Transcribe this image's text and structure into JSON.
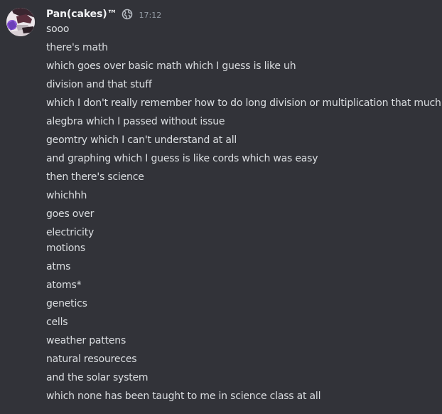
{
  "message": {
    "username": "Pan(cakes)™",
    "timestamp": "17:12",
    "badge_icon": "globe-icon",
    "lines": [
      "sooo",
      "there's math",
      "which goes over basic math which I guess is like uh",
      "division and that stuff",
      "which I don't really remember how to do long division or multiplication that much",
      "alegbra which I passed without issue",
      "geomtry which I can't understand at all",
      "and graphing which I guess is like cords which was easy",
      "then there's science",
      "whichhh",
      "goes over",
      "electricity",
      "motions",
      "atms",
      "atoms*",
      "genetics",
      "cells",
      "weather pattens",
      "natural resoureces",
      "and the solar system",
      "which none has been taught to me in science class at all"
    ]
  },
  "colors": {
    "background": "#323339",
    "username": "#f2f3f5",
    "text": "#dbdee1",
    "timestamp": "#949ba4"
  }
}
